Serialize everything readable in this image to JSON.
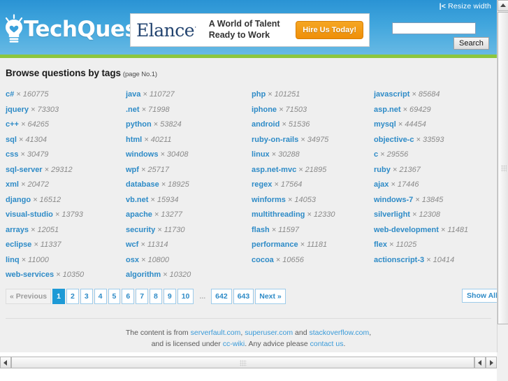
{
  "browser": {
    "resize_width_label": "Resize width",
    "resize_icon": "resize-left-arrow-icon"
  },
  "header": {
    "logo_text": "TechQues",
    "logo_icon": "lightbulb-heart-icon",
    "search": {
      "value": "",
      "placeholder": "",
      "button_label": "Search"
    },
    "ad": {
      "brand": "Elance",
      "registered_mark": "·",
      "tagline_line1": "A World of Talent",
      "tagline_line2": "Ready to Work",
      "cta_label": "Hire Us Today!",
      "cta_color": "#ef8f08"
    },
    "accent_color": "#8cc63e",
    "background_color": "#41a6dd"
  },
  "content": {
    "heading": "Browse questions by tags",
    "heading_sub": "(page No.1)",
    "multiplier_symbol": "×",
    "tag_link_color": "#2e8bc7",
    "tag_count_color": "#8a8a8a",
    "columns": [
      [
        {
          "name": "c#",
          "count": "160775"
        },
        {
          "name": "jquery",
          "count": "73303"
        },
        {
          "name": "c++",
          "count": "64265"
        },
        {
          "name": "sql",
          "count": "41304"
        },
        {
          "name": "css",
          "count": "30479"
        },
        {
          "name": "sql-server",
          "count": "29312"
        },
        {
          "name": "xml",
          "count": "20472"
        },
        {
          "name": "django",
          "count": "16512"
        },
        {
          "name": "visual-studio",
          "count": "13793"
        },
        {
          "name": "arrays",
          "count": "12051"
        },
        {
          "name": "eclipse",
          "count": "11337"
        },
        {
          "name": "linq",
          "count": "11000"
        },
        {
          "name": "web-services",
          "count": "10350"
        }
      ],
      [
        {
          "name": "java",
          "count": "110727"
        },
        {
          "name": ".net",
          "count": "71998"
        },
        {
          "name": "python",
          "count": "53824"
        },
        {
          "name": "html",
          "count": "40211"
        },
        {
          "name": "windows",
          "count": "30408"
        },
        {
          "name": "wpf",
          "count": "25717"
        },
        {
          "name": "database",
          "count": "18925"
        },
        {
          "name": "vb.net",
          "count": "15934"
        },
        {
          "name": "apache",
          "count": "13277"
        },
        {
          "name": "security",
          "count": "11730"
        },
        {
          "name": "wcf",
          "count": "11314"
        },
        {
          "name": "osx",
          "count": "10800"
        },
        {
          "name": "algorithm",
          "count": "10320"
        }
      ],
      [
        {
          "name": "php",
          "count": "101251"
        },
        {
          "name": "iphone",
          "count": "71503"
        },
        {
          "name": "android",
          "count": "51536"
        },
        {
          "name": "ruby-on-rails",
          "count": "34975"
        },
        {
          "name": "linux",
          "count": "30288"
        },
        {
          "name": "asp.net-mvc",
          "count": "21895"
        },
        {
          "name": "regex",
          "count": "17564"
        },
        {
          "name": "winforms",
          "count": "14053"
        },
        {
          "name": "multithreading",
          "count": "12330"
        },
        {
          "name": "flash",
          "count": "11597"
        },
        {
          "name": "performance",
          "count": "11181"
        },
        {
          "name": "cocoa",
          "count": "10656"
        }
      ],
      [
        {
          "name": "javascript",
          "count": "85684"
        },
        {
          "name": "asp.net",
          "count": "69429"
        },
        {
          "name": "mysql",
          "count": "44454"
        },
        {
          "name": "objective-c",
          "count": "33593"
        },
        {
          "name": "c",
          "count": "29556"
        },
        {
          "name": "ruby",
          "count": "21367"
        },
        {
          "name": "ajax",
          "count": "17446"
        },
        {
          "name": "windows-7",
          "count": "13845"
        },
        {
          "name": "silverlight",
          "count": "12308"
        },
        {
          "name": "web-development",
          "count": "11481"
        },
        {
          "name": "flex",
          "count": "11025"
        },
        {
          "name": "actionscript-3",
          "count": "10414"
        }
      ]
    ]
  },
  "pagination": {
    "previous_label": "« Previous",
    "next_label": "Next »",
    "gap_label": "...",
    "active_page": "1",
    "pages": [
      "1",
      "2",
      "3",
      "4",
      "5",
      "6",
      "7",
      "8",
      "9",
      "10"
    ],
    "tail_pages": [
      "642",
      "643"
    ],
    "show_all_label": "Show All",
    "active_color": "#1e9ad6"
  },
  "footer": {
    "line1_prefix": "The content is from ",
    "link_serverfault": "serverfault.com",
    "sep1": ", ",
    "link_superuser": "superuser.com",
    "sep2": " and ",
    "link_stackoverflow": "stackoverflow.com",
    "line1_suffix": ",",
    "line2_prefix": "and is licensed under ",
    "link_ccwiki": "cc-wiki",
    "line2_mid": ". Any advice please ",
    "link_contact": "contact us",
    "line2_suffix": "."
  }
}
